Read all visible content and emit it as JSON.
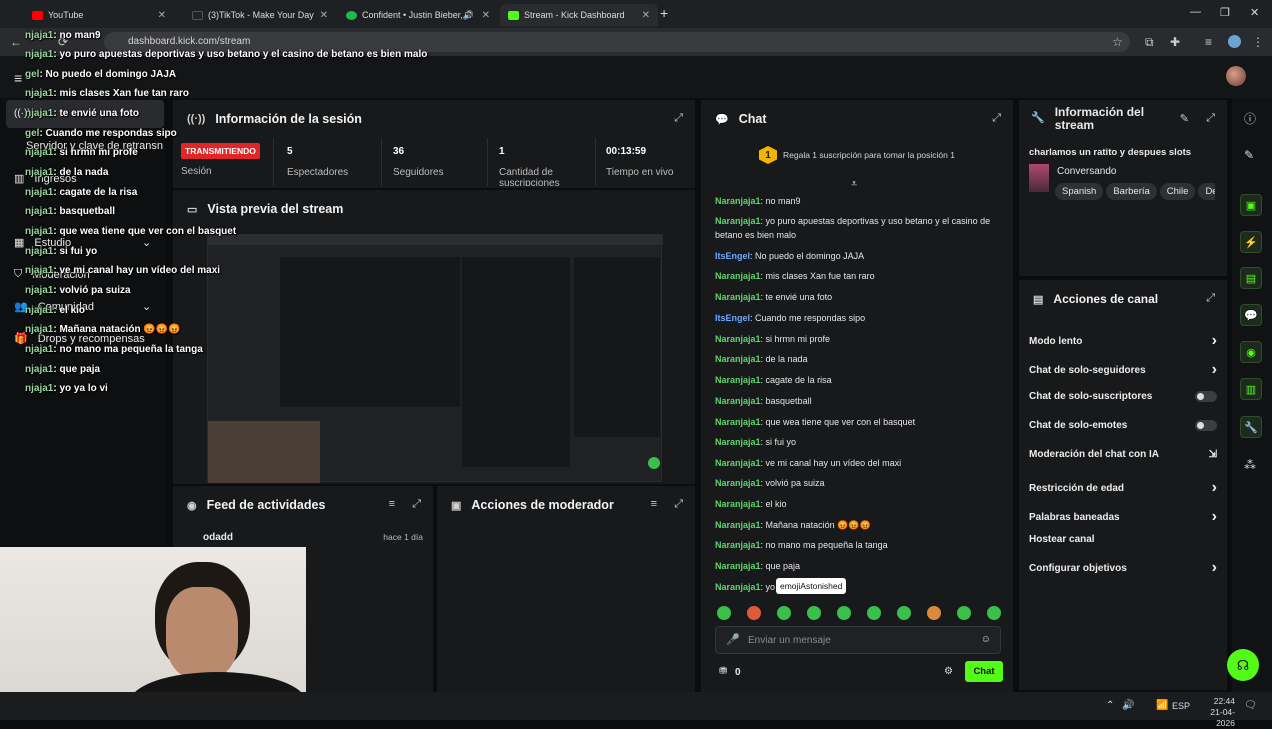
{
  "browser": {
    "tabs": [
      {
        "title": "YouTube",
        "color": "#ff0000"
      },
      {
        "title": "(3)TikTok - Make Your Day",
        "color": "#111111"
      },
      {
        "title": "Confident • Justin Bieber, C",
        "color": "#1db954"
      },
      {
        "title": "Stream - Kick Dashboard",
        "color": "#53fc18"
      }
    ],
    "new_tab": "+",
    "url": "dashboard.kick.com/stream"
  },
  "overlay_chat": [
    {
      "user": "njaja1",
      "text": ": no man9"
    },
    {
      "user": "njaja1",
      "text": ": yo puro apuestas deportivas y uso betano y el casino de betano es bien malo"
    },
    {
      "user": "gel",
      "text": ": No puedo el domingo JAJA"
    },
    {
      "user": "njaja1",
      "text": ": mis clases Xan fue tan raro"
    },
    {
      "user": "njaja1",
      "text": ": te envié una foto"
    },
    {
      "user": "gel",
      "text": ": Cuando me respondas sipo"
    },
    {
      "user": "njaja1",
      "text": ": si hrmn mi profe"
    },
    {
      "user": "njaja1",
      "text": ": de la nada"
    },
    {
      "user": "njaja1",
      "text": ": cagate de la risa"
    },
    {
      "user": "njaja1",
      "text": ": basquetball"
    },
    {
      "user": "njaja1",
      "text": ": que wea tiene que ver con el basquet"
    },
    {
      "user": "njaja1",
      "text": ": si fui yo"
    },
    {
      "user": "njaja1",
      "text": ": ve mi canal hay un vídeo del maxi"
    },
    {
      "user": "njaja1",
      "text": ": volvió pa suiza"
    },
    {
      "user": "njaja1",
      "text": ": el kio"
    },
    {
      "user": "njaja1",
      "text": ": Mañana natación 😡😡😡"
    },
    {
      "user": "njaja1",
      "text": ": no mano ma pequeña la tanga"
    },
    {
      "user": "njaja1",
      "text": ": que paja"
    },
    {
      "user": "njaja1",
      "text": ": yo ya lo vi"
    }
  ],
  "sidebar": {
    "items": [
      {
        "label": "Servidor y clave de retransn"
      },
      {
        "label": "Ingresos"
      },
      {
        "label": "Estudio"
      },
      {
        "label": "Moderación"
      },
      {
        "label": "Comunidad"
      },
      {
        "label": "Drops y recompensas"
      }
    ]
  },
  "session": {
    "title": "Información de la sesión",
    "status": "TRANSMITIENDO",
    "session_label": "Sesión",
    "stats": [
      {
        "value": "5",
        "label": "Espectadores"
      },
      {
        "value": "36",
        "label": "Seguidores"
      },
      {
        "value": "1",
        "label": "Cantidad de suscripciones"
      },
      {
        "value": "00:13:59",
        "label": "Tiempo en vivo"
      }
    ]
  },
  "preview": {
    "title": "Vista previa del stream"
  },
  "feed": {
    "title": "Feed de actividades",
    "item_user": "odadd",
    "item_time": "hace 1 día"
  },
  "moderator": {
    "title": "Acciones de moderador"
  },
  "chat": {
    "title": "Chat",
    "gift_badge": "1",
    "gift_text": "Regala 1 suscripción para tomar la posición 1",
    "messages": [
      {
        "user": "Naranjaja1",
        "text": ": no man9"
      },
      {
        "user": "Naranjaja1",
        "text": ": yo puro apuestas deportivas y uso betano y el casino de betano es bien malo"
      },
      {
        "user": "ItsEngel",
        "text": ": No puedo el domingo JAJA"
      },
      {
        "user": "Naranjaja1",
        "text": ": mis clases Xan fue tan raro"
      },
      {
        "user": "Naranjaja1",
        "text": ": te envié una foto"
      },
      {
        "user": "ItsEngel",
        "text": ": Cuando me respondas sipo"
      },
      {
        "user": "Naranjaja1",
        "text": ": si hrmn mi profe"
      },
      {
        "user": "Naranjaja1",
        "text": ": de la nada"
      },
      {
        "user": "Naranjaja1",
        "text": ": cagate de la risa"
      },
      {
        "user": "Naranjaja1",
        "text": ": basquetball"
      },
      {
        "user": "Naranjaja1",
        "text": ": que wea tiene que ver con el basquet"
      },
      {
        "user": "Naranjaja1",
        "text": ": si fui yo"
      },
      {
        "user": "Naranjaja1",
        "text": ": ve mi canal hay un vídeo del maxi"
      },
      {
        "user": "Naranjaja1",
        "text": ": volvió pa suiza"
      },
      {
        "user": "Naranjaja1",
        "text": ": el kio"
      },
      {
        "user": "Naranjaja1",
        "text": ": Mañana natación 😡😡😡"
      },
      {
        "user": "Naranjaja1",
        "text": ": no mano ma pequeña la tanga"
      },
      {
        "user": "Naranjaja1",
        "text": ": que paja"
      },
      {
        "user": "Naranjaja1",
        "text": ": yo"
      }
    ],
    "tooltip": "emojiAstonished",
    "input_placeholder": "Enviar un mensaje",
    "points": "0",
    "send_label": "Chat"
  },
  "stream_info": {
    "title": "Información del stream",
    "stream_title": "charlamos un ratito y despues slots",
    "category": "Conversando",
    "tags": [
      "Spanish",
      "Barbería",
      "Chile",
      "De"
    ]
  },
  "channel_actions": {
    "title": "Acciones de canal",
    "items": [
      {
        "label": "Modo lento",
        "control": "chevron"
      },
      {
        "label": "Chat de solo-seguidores",
        "control": "chevron"
      },
      {
        "label": "Chat de solo-suscriptores",
        "control": "toggle"
      },
      {
        "label": "Chat de solo-emotes",
        "control": "toggle"
      },
      {
        "label": "Moderación del chat con IA",
        "control": "external"
      },
      {
        "label": "Restricción de edad",
        "control": "chevron"
      },
      {
        "label": "Palabras baneadas",
        "control": "chevron"
      },
      {
        "label": "Hostear canal",
        "control": "none"
      },
      {
        "label": "Configurar objetivos",
        "control": "chevron"
      }
    ]
  },
  "taskbar": {
    "lang": "ESP",
    "time": "22:44",
    "date": "21-04-2026"
  },
  "colors": {
    "accent": "#53fc18",
    "live": "#e02626",
    "panel": "#18191b"
  }
}
